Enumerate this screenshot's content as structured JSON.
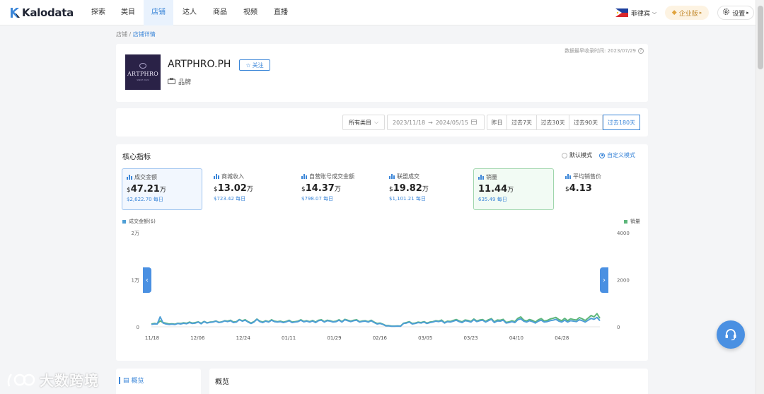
{
  "brand": {
    "name": "Kalodata"
  },
  "nav": {
    "items": [
      {
        "label": "探索"
      },
      {
        "label": "类目"
      },
      {
        "label": "店铺"
      },
      {
        "label": "达人"
      },
      {
        "label": "商品"
      },
      {
        "label": "视频"
      },
      {
        "label": "直播"
      }
    ],
    "active_index": 2,
    "region": "菲律宾",
    "enterprise": "企业版",
    "settings": "设置"
  },
  "breadcrumb": {
    "root": "店铺",
    "sep": "/",
    "current": "店铺详情"
  },
  "store": {
    "name": "ARTPHRO.PH",
    "logo_text": "ARTPHRO",
    "logo_sub": "SINCE 2022",
    "follow_label": "关注",
    "tag": "品牌",
    "data_time": "数据最早收录时间: 2023/07/29"
  },
  "filters": {
    "category": "所有类目",
    "date_start": "2023/11/18",
    "date_sep": "→",
    "date_end": "2024/05/15",
    "ranges": [
      "昨日",
      "过去7天",
      "过去30天",
      "过去90天",
      "过去180天"
    ],
    "active_range": 4
  },
  "metrics_section": {
    "title": "核心指标",
    "mode_default": "默认模式",
    "mode_custom": "自定义模式"
  },
  "metrics": [
    {
      "label": "成交金额",
      "currency": "$",
      "value": "47.21",
      "unit": "万",
      "sub": "$2,622.70 每日"
    },
    {
      "label": "商城收入",
      "currency": "$",
      "value": "13.02",
      "unit": "万",
      "sub": "$723.42 每日"
    },
    {
      "label": "自营账号成交金额",
      "currency": "$",
      "value": "14.37",
      "unit": "万",
      "sub": "$798.07 每日"
    },
    {
      "label": "联盟成交",
      "currency": "$",
      "value": "19.82",
      "unit": "万",
      "sub": "$1,101.21 每日"
    },
    {
      "label": "销量",
      "currency": "",
      "value": "11.44",
      "unit": "万",
      "sub": "635.49 每日"
    },
    {
      "label": "平均销售价",
      "currency": "$",
      "value": "4.13",
      "unit": "",
      "sub": ""
    }
  ],
  "chart_data": {
    "type": "line",
    "x_ticks": [
      "11/18",
      "12/06",
      "12/24",
      "01/11",
      "01/29",
      "02/16",
      "03/05",
      "03/23",
      "04/10",
      "04/28"
    ],
    "y_left": {
      "ticks": [
        "0",
        "1万",
        "2万"
      ],
      "range": [
        0,
        20000
      ]
    },
    "y_right": {
      "ticks": [
        "0",
        "2000",
        "4000"
      ],
      "range": [
        0,
        4000
      ]
    },
    "series": [
      {
        "name": "成交金额($)",
        "axis": "left",
        "color": "#4f9fd6",
        "values": [
          500,
          600,
          600,
          2100,
          800,
          600,
          500,
          550,
          480,
          700,
          600,
          750,
          650,
          900,
          700,
          800,
          1000,
          650,
          1100,
          800,
          950,
          1000,
          1200,
          900,
          1000,
          1250,
          1100,
          1300,
          900,
          1000,
          1500,
          1200,
          1400,
          1000,
          700,
          1000,
          1600,
          1100,
          900,
          1200,
          1000,
          1400,
          1100,
          1000,
          1100,
          900,
          1050,
          1300,
          900,
          1000,
          1100,
          1400,
          1050,
          1200,
          1000,
          1250,
          900,
          1300,
          1400,
          1000,
          1300,
          1200,
          1000,
          1100,
          1400,
          1000,
          1500,
          1300,
          1100,
          1300,
          1400,
          1000,
          1150,
          1200,
          1000,
          1300,
          900,
          600,
          700,
          500,
          200,
          200,
          100,
          100,
          150,
          100,
          700,
          800,
          1000,
          600,
          700,
          900,
          800,
          1000,
          700,
          900,
          1000,
          1200,
          1100,
          1300,
          800,
          1100,
          1000,
          1200,
          1400,
          1100,
          900,
          1300,
          1200,
          1000,
          1500,
          1100,
          1300,
          1400,
          1000,
          1300,
          1600,
          900,
          1250,
          1200,
          1400,
          800,
          900,
          1100,
          900,
          1500,
          1700,
          1200,
          1000,
          1300,
          1100,
          800,
          1200,
          1400,
          1000,
          1100,
          1300,
          1400,
          1600,
          1200,
          1000,
          1400,
          1000,
          1300,
          1200,
          1100,
          1500,
          1300,
          1000,
          1400,
          1800,
          1600,
          2000,
          1300
        ]
      },
      {
        "name": "销量",
        "axis": "right",
        "color": "#5cb67a",
        "values": [
          120,
          140,
          130,
          250,
          180,
          150,
          120,
          130,
          110,
          150,
          140,
          170,
          150,
          200,
          160,
          180,
          210,
          150,
          230,
          170,
          200,
          210,
          250,
          190,
          210,
          260,
          240,
          280,
          200,
          220,
          310,
          260,
          300,
          220,
          160,
          220,
          330,
          240,
          200,
          260,
          220,
          300,
          240,
          220,
          240,
          200,
          230,
          280,
          200,
          220,
          240,
          300,
          230,
          260,
          220,
          270,
          200,
          280,
          300,
          220,
          280,
          260,
          220,
          240,
          300,
          220,
          320,
          280,
          240,
          280,
          300,
          220,
          250,
          260,
          220,
          280,
          200,
          140,
          160,
          110,
          50,
          50,
          30,
          30,
          40,
          30,
          150,
          180,
          220,
          140,
          160,
          200,
          180,
          220,
          160,
          200,
          220,
          260,
          240,
          290,
          180,
          240,
          230,
          270,
          310,
          250,
          210,
          290,
          270,
          230,
          330,
          250,
          290,
          310,
          230,
          300,
          350,
          210,
          290,
          280,
          320,
          190,
          210,
          260,
          220,
          360,
          420,
          290,
          250,
          310,
          270,
          200,
          300,
          350,
          250,
          270,
          330,
          360,
          400,
          310,
          260,
          360,
          260,
          340,
          310,
          290,
          390,
          340,
          270,
          370,
          480,
          420,
          560,
          360
        ]
      }
    ],
    "grid": false,
    "legend": "top"
  },
  "bottom": {
    "side_label": "概览",
    "overview_title": "概览"
  },
  "watermark": "大数跨境"
}
